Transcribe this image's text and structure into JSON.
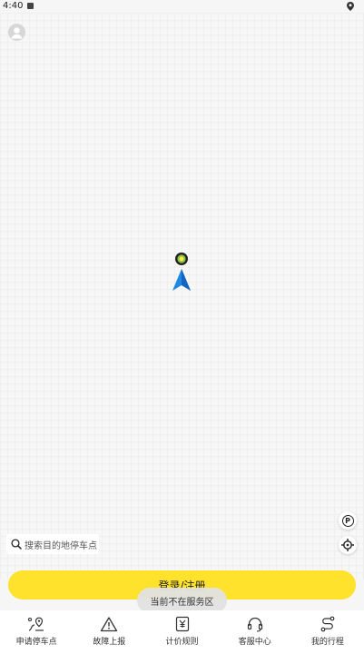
{
  "status_bar": {
    "time": "4:40"
  },
  "search": {
    "placeholder": "搜索目的地停车点"
  },
  "map_controls": {
    "parking_label": "P"
  },
  "login_button": {
    "label": "登录/注册"
  },
  "toast": {
    "message": "当前不在服务区"
  },
  "bottom_nav": [
    {
      "label": "申请停车点",
      "icon": "map-pin-icon"
    },
    {
      "label": "故障上报",
      "icon": "warning-icon"
    },
    {
      "label": "计价规则",
      "icon": "yen-icon"
    },
    {
      "label": "客服中心",
      "icon": "headset-icon"
    },
    {
      "label": "我的行程",
      "icon": "route-icon"
    }
  ],
  "colors": {
    "accent": "#ffe22b",
    "arrow": "#1e88e5"
  }
}
